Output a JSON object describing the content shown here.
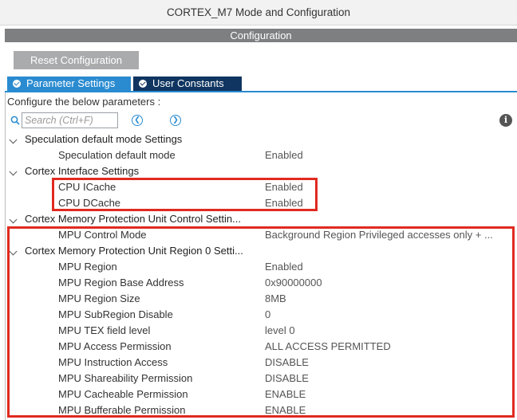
{
  "window": {
    "title": "CORTEX_M7 Mode and Configuration"
  },
  "section": {
    "header": "Configuration"
  },
  "toolbar": {
    "reset_label": "Reset Configuration"
  },
  "tabs": [
    {
      "label": "Parameter Settings",
      "active": true
    },
    {
      "label": "User Constants",
      "active": false
    }
  ],
  "panel": {
    "hint": "Configure the below parameters :"
  },
  "search": {
    "placeholder": "Search (Ctrl+F)"
  },
  "icons": {
    "search": "search-icon",
    "prev": "chevron-left-icon",
    "next": "chevron-right-icon",
    "info": "info-icon",
    "expand": "chevron-down-icon"
  },
  "colors": {
    "active_tab": "#2a8bd0",
    "inactive_tab": "#0f3560",
    "highlight": "#e02a20",
    "section_header": "#7d7f81"
  },
  "groups": [
    {
      "label": "Speculation default mode Settings",
      "params": [
        {
          "name": "Speculation default mode",
          "value": "Enabled"
        }
      ]
    },
    {
      "label": "Cortex Interface Settings",
      "params": [
        {
          "name": "CPU ICache",
          "value": "Enabled"
        },
        {
          "name": "CPU DCache",
          "value": "Enabled"
        }
      ]
    },
    {
      "label": "Cortex Memory Protection Unit Control Settin...",
      "params": [
        {
          "name": "MPU Control Mode",
          "value": "Background Region Privileged accesses only + ..."
        }
      ]
    },
    {
      "label": "Cortex Memory Protection Unit Region 0 Setti...",
      "params": [
        {
          "name": "MPU Region",
          "value": "Enabled"
        },
        {
          "name": "MPU Region Base Address",
          "value": "0x90000000"
        },
        {
          "name": "MPU Region Size",
          "value": "8MB"
        },
        {
          "name": "MPU SubRegion Disable",
          "value": "0"
        },
        {
          "name": "MPU TEX field level",
          "value": "level 0"
        },
        {
          "name": "MPU Access Permission",
          "value": "ALL ACCESS PERMITTED"
        },
        {
          "name": "MPU Instruction Access",
          "value": "DISABLE"
        },
        {
          "name": "MPU Shareability Permission",
          "value": "DISABLE"
        },
        {
          "name": "MPU Cacheable Permission",
          "value": "ENABLE"
        },
        {
          "name": "MPU Bufferable  Permission",
          "value": "ENABLE"
        }
      ]
    }
  ]
}
